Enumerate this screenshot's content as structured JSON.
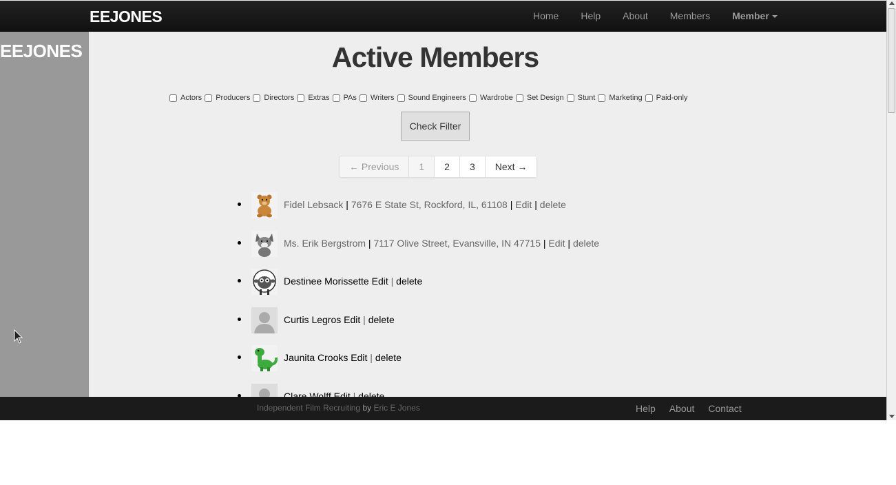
{
  "navbar": {
    "brand": "EEJONES",
    "links": [
      "Home",
      "Help",
      "About",
      "Members"
    ],
    "dropdown_label": "Member"
  },
  "sidebar": {
    "brand": "EEJONES"
  },
  "main": {
    "title": "Active Members",
    "filters": [
      "Actors",
      "Producers",
      "Directors",
      "Extras",
      "PAs",
      "Writers",
      "Sound Engineers",
      "Wardrobe",
      "Set Design",
      "Stunt",
      "Marketing",
      "Paid-only"
    ],
    "check_filter_label": "Check Filter",
    "pagination": {
      "previous": "← Previous",
      "pages": [
        "1",
        "2",
        "3"
      ],
      "next": "Next →"
    }
  },
  "members": [
    {
      "name": "Fidel Lebsack",
      "address": "7676 E State St, Rockford, IL, 61108",
      "edit": "Edit",
      "delete": "delete",
      "avatar": "bear-icon"
    },
    {
      "name": "Ms. Erik Bergstrom",
      "address": "7117 Olive Street, Evansville, IN 47715",
      "edit": "Edit",
      "delete": "delete",
      "avatar": "wolf-icon"
    },
    {
      "name": "Destinee Morissette",
      "edit": "Edit",
      "delete": "delete",
      "avatar": "sheep-icon"
    },
    {
      "name": "Curtis Legros",
      "edit": "Edit",
      "delete": "delete",
      "avatar": "default-avatar-icon"
    },
    {
      "name": "Jaunita Crooks",
      "edit": "Edit",
      "delete": "delete",
      "avatar": "dinosaur-icon"
    },
    {
      "name": "Clare Wolff",
      "edit": "Edit",
      "delete": "delete",
      "avatar": "default-avatar-icon"
    }
  ],
  "footer": {
    "credit": "Independent Film Recruiting",
    "by": "by",
    "author": "Eric E Jones",
    "links": [
      "Help",
      "About",
      "Contact"
    ]
  },
  "colors": {
    "navbar": "#1b1b1b",
    "sidebar": "#999999",
    "content_bg": "#eeeeee"
  }
}
